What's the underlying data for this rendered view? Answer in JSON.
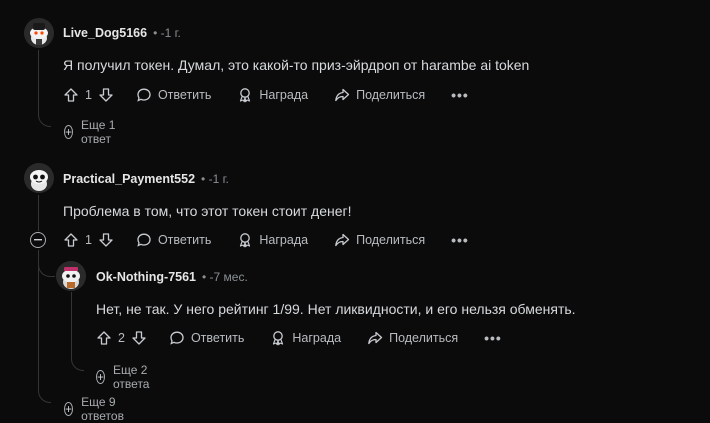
{
  "comments": [
    {
      "username": "Live_Dog5166",
      "time": "• -1 г.",
      "text": "Я получил токен. Думал, это какой-то приз-эйрдроп от harambe ai token",
      "votes": "1",
      "reply_label": "Ответить",
      "award_label": "Награда",
      "share_label": "Поделиться",
      "more_label": "•••",
      "more_replies": "Еще 1 ответ"
    },
    {
      "username": "Practical_Payment552",
      "time": "• -1 г.",
      "text": "Проблема в том, что этот токен стоит денег!",
      "votes": "1",
      "reply_label": "Ответить",
      "award_label": "Награда",
      "share_label": "Поделиться",
      "more_label": "•••",
      "more_replies": "Еще 9 ответов"
    },
    {
      "username": "Ok-Nothing-7561",
      "time": "• -7 мес.",
      "text": "Нет, не так. У него рейтинг 1/99. Нет ликвидности, и его нельзя обменять.",
      "votes": "2",
      "reply_label": "Ответить",
      "award_label": "Награда",
      "share_label": "Поделиться",
      "more_label": "•••",
      "more_replies": "Еще 2 ответа"
    }
  ],
  "icons": {
    "upvote": "arrow-up-icon",
    "downvote": "arrow-down-icon",
    "reply": "comment-bubble-icon",
    "award": "award-icon",
    "share": "share-arrow-icon",
    "expand": "plus-circle-icon",
    "collapse": "minus-circle-icon"
  }
}
